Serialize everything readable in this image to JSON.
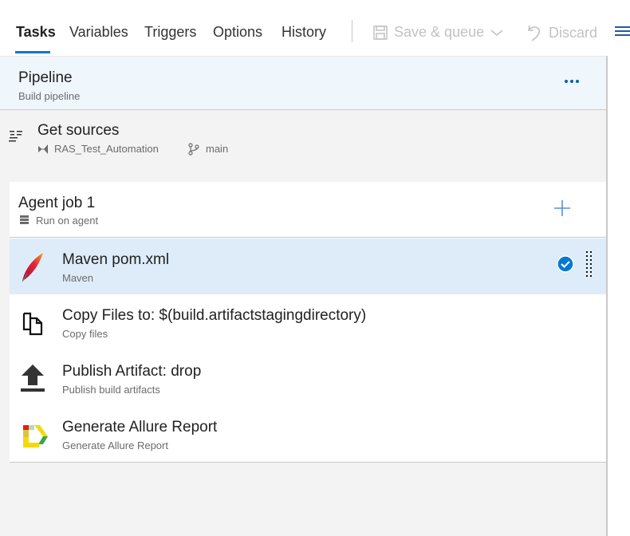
{
  "tabs": [
    {
      "label": "Tasks",
      "active": true
    },
    {
      "label": "Variables",
      "active": false
    },
    {
      "label": "Triggers",
      "active": false
    },
    {
      "label": "Options",
      "active": false
    },
    {
      "label": "History",
      "active": false
    }
  ],
  "toolbar": {
    "save_queue_label": "Save & queue",
    "discard_label": "Discard",
    "save_icon": "save-icon",
    "undo_icon": "undo-icon",
    "list_icon": "list-icon"
  },
  "pipeline": {
    "title": "Pipeline",
    "subtitle": "Build pipeline"
  },
  "get_sources": {
    "title": "Get sources",
    "repo": "RAS_Test_Automation",
    "branch": "main"
  },
  "agent_job": {
    "title": "Agent job 1",
    "subtitle": "Run on agent"
  },
  "tasks": [
    {
      "title": "Maven pom.xml",
      "subtitle": "Maven",
      "icon": "maven-feather-icon",
      "selected": true,
      "enabled": true
    },
    {
      "title": "Copy Files to: $(build.artifactstagingdirectory)",
      "subtitle": "Copy files",
      "icon": "copy-files-icon",
      "selected": false
    },
    {
      "title": "Publish Artifact: drop",
      "subtitle": "Publish build artifacts",
      "icon": "upload-icon",
      "selected": false
    },
    {
      "title": "Generate Allure Report",
      "subtitle": "Generate Allure Report",
      "icon": "allure-icon",
      "selected": false
    }
  ],
  "colors": {
    "accent": "#0078d4",
    "selected_bg": "#deecf9",
    "pipeline_bg": "#eff6fc"
  }
}
